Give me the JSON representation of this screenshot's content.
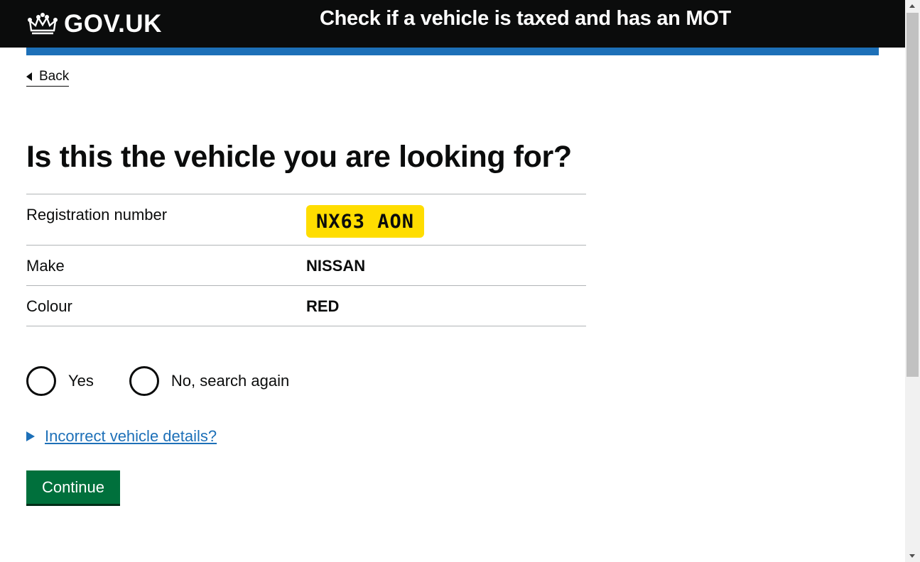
{
  "header": {
    "logo_text": "GOV.UK",
    "logo_icon": "crown-icon",
    "service_name": "Check if a vehicle is taxed and has an MOT"
  },
  "nav": {
    "back_label": "Back"
  },
  "main": {
    "heading": "Is this the vehicle you are looking for?",
    "summary": {
      "registration_label": "Registration number",
      "registration_value": "NX63 AON",
      "make_label": "Make",
      "make_value": "NISSAN",
      "colour_label": "Colour",
      "colour_value": "RED"
    },
    "radios": [
      {
        "label": "Yes",
        "selected": false
      },
      {
        "label": "No, search again",
        "selected": false
      }
    ],
    "details_link": "Incorrect vehicle details?",
    "continue_label": "Continue"
  },
  "colors": {
    "header_bg": "#0b0c0c",
    "accent_blue": "#1d70b8",
    "plate_yellow": "#ffdd00",
    "button_green": "#00703c"
  }
}
